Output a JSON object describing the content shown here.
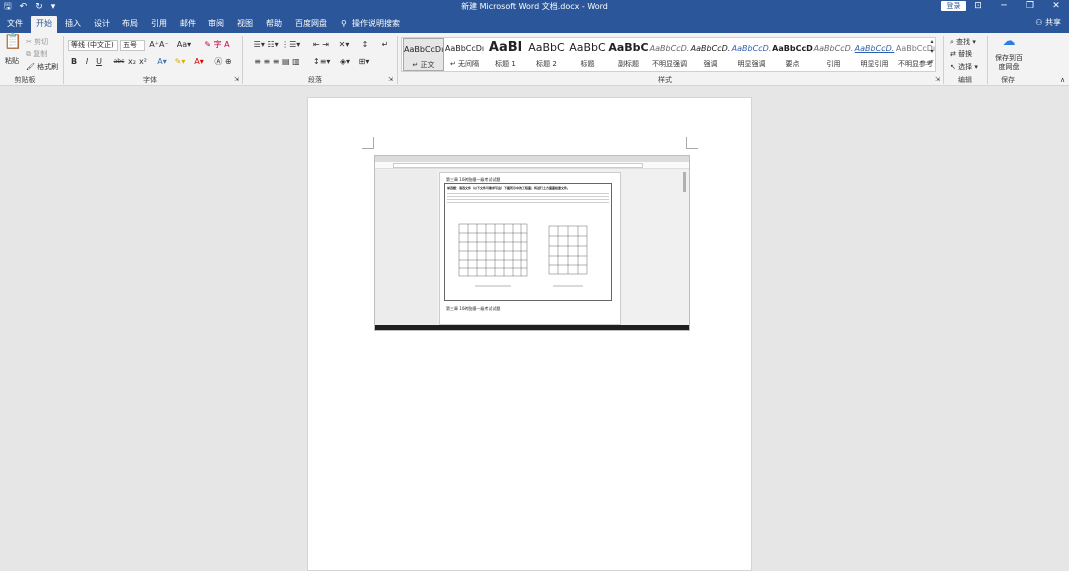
{
  "app": {
    "title": "新建 Microsoft Word 文档.docx - Word",
    "login_label": "登录",
    "share_label": "共享",
    "qat": [
      "🖫",
      "↶",
      "↻",
      "▾"
    ]
  },
  "tabs": [
    {
      "label": "文件"
    },
    {
      "label": "开始"
    },
    {
      "label": "插入"
    },
    {
      "label": "设计"
    },
    {
      "label": "布局"
    },
    {
      "label": "引用"
    },
    {
      "label": "邮件"
    },
    {
      "label": "审阅"
    },
    {
      "label": "视图"
    },
    {
      "label": "帮助"
    },
    {
      "label": "百度网盘"
    },
    {
      "label": "操作说明搜索"
    }
  ],
  "active_tab": "开始",
  "clipboard": {
    "paste": "粘贴",
    "cut": "剪切",
    "copy": "复制",
    "format_painter": "格式刷",
    "label": "剪贴板"
  },
  "font": {
    "family": "等线 (中文正)",
    "size": "五号",
    "label": "字体",
    "buttons": [
      "B",
      "I",
      "U",
      "abc",
      "x₂",
      "x²"
    ]
  },
  "paragraph": {
    "label": "段落"
  },
  "styles": {
    "label": "样式",
    "items": [
      {
        "preview": "AaBbCcDı",
        "name": "↵ 正文"
      },
      {
        "preview": "AaBbCcDı",
        "name": "↵ 无间隔"
      },
      {
        "preview": "AaBl",
        "name": "标题 1"
      },
      {
        "preview": "AaBbC",
        "name": "标题 2"
      },
      {
        "preview": "AaBbC",
        "name": "标题"
      },
      {
        "preview": "AaBbC",
        "name": "副标题"
      },
      {
        "preview": "AaBbCcD.",
        "name": "不明显强调"
      },
      {
        "preview": "AaBbCcD.",
        "name": "强调"
      },
      {
        "preview": "AaBbCcD.",
        "name": "明显强调"
      },
      {
        "preview": "AaBbCcD",
        "name": "要点"
      },
      {
        "preview": "AaBbCcD.",
        "name": "引用"
      },
      {
        "preview": "AaBbCcD.",
        "name": "明显引用"
      },
      {
        "preview": "AaBbCcDı",
        "name": "不明显参考"
      }
    ]
  },
  "editing": {
    "find": "查找",
    "replace": "替换",
    "select": "选择",
    "label": "编辑"
  },
  "save": {
    "button": "保存到百度网盘",
    "label": "保存"
  },
  "embedded": {
    "doc_header": "第三章 10砖胎膜一级考试试题",
    "question": "单选题：请选文件（以下文件可要求写出）下图所示中的工程量；将进行土方量量检查文件。",
    "doc_header2": "第三章 10砖胎膜一级考试试题"
  }
}
